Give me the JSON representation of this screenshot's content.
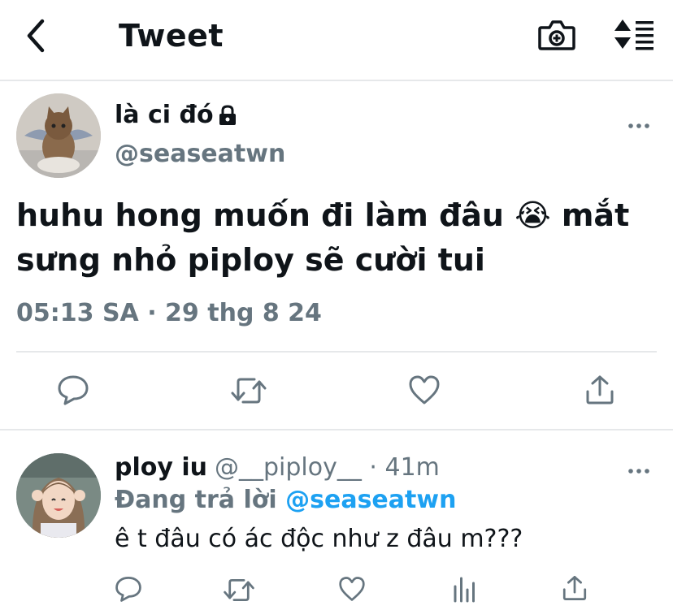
{
  "header": {
    "title": "Tweet",
    "back_icon": "chevron-left-icon",
    "camera_icon": "camera-add-icon",
    "sort_icon": "sort-icon"
  },
  "tweet": {
    "display_name": "là ci đó",
    "locked": true,
    "username": "@seaseatwn",
    "text": "huhu hong muốn đi làm đâu 😭 mắt sưng nhỏ piploy sẽ cười tui",
    "timestamp": "05:13 SA · 29 thg 8 24",
    "actions": [
      "reply-icon",
      "retweet-icon",
      "like-icon",
      "share-icon"
    ]
  },
  "reply": {
    "display_name": "ploy iu",
    "username": "@__piploy__",
    "time": "· 41m",
    "replying_prefix": "Đang trả lời",
    "replying_to": "@seaseatwn",
    "text": "ê t đâu có ác độc như z đâu m???",
    "actions": [
      "reply-icon",
      "retweet-icon",
      "like-icon",
      "analytics-icon",
      "share-icon"
    ]
  },
  "colors": {
    "text": "#0f1419",
    "secondary": "#66757f",
    "accent": "#1da1f2",
    "divider": "#e6e8ea"
  }
}
